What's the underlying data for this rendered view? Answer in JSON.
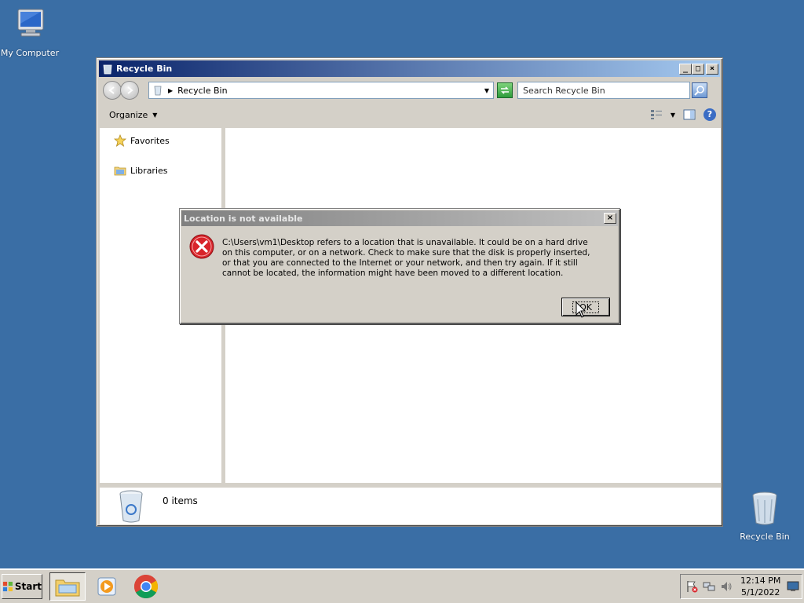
{
  "desktop": {
    "icons": [
      {
        "label": "My Computer"
      },
      {
        "label": "Recycle Bin"
      }
    ]
  },
  "explorer": {
    "title": "Recycle Bin",
    "address": {
      "path": "Recycle Bin"
    },
    "search": {
      "placeholder": "Search Recycle Bin"
    },
    "command_bar": {
      "organize_label": "Organize"
    },
    "nav_pane": {
      "items": [
        {
          "label": "Favorites",
          "icon": "star-icon"
        },
        {
          "label": "Libraries",
          "icon": "libraries-icon"
        }
      ]
    },
    "details": {
      "item_count": "0 items"
    }
  },
  "dialog": {
    "title": "Location is not available",
    "message": "C:\\Users\\vm1\\Desktop refers to a location that is unavailable. It could be on a hard drive on this computer, or on a network. Check to make sure that the disk is properly inserted, or that you are connected to the Internet or your network, and then try again. If it still cannot be located, the information might have been moved to a different location.",
    "ok_label": "OK",
    "icon": "error-icon"
  },
  "taskbar": {
    "start_label": "Start",
    "apps": [
      "windows-explorer-icon",
      "media-player-icon",
      "chrome-icon"
    ],
    "clock": {
      "time": "12:14 PM",
      "date": "5/1/2022"
    }
  },
  "colors": {
    "desktop_bg": "#3a6ea5",
    "titlebar_active": "#0a246a",
    "titlebar_inactive": "#808080"
  }
}
